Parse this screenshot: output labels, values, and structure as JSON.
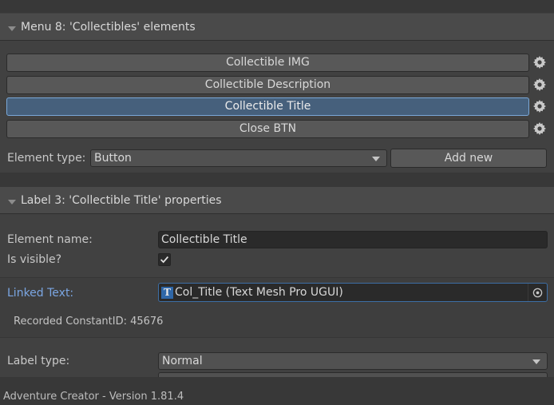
{
  "menu_section": {
    "title": "Menu 8: 'Collectibles' elements",
    "elements": [
      {
        "label": "Collectible IMG",
        "selected": false
      },
      {
        "label": "Collectible Description",
        "selected": false
      },
      {
        "label": "Collectible Title",
        "selected": true
      },
      {
        "label": "Close BTN",
        "selected": false
      }
    ],
    "element_type_label": "Element type:",
    "element_type_value": "Button",
    "add_new_label": "Add new"
  },
  "properties_section": {
    "title": "Label 3: 'Collectible Title' properties",
    "element_name_label": "Element name:",
    "element_name_value": "Collectible Title",
    "is_visible_label": "Is visible?",
    "is_visible_checked": true,
    "linked_text_label": "Linked Text:",
    "linked_text_value": "Col_Title (Text Mesh Pro UGUI)",
    "linked_text_icon": "T",
    "recorded_constant_id": "Recorded ConstantID: 45676",
    "label_type_label": "Label type:",
    "label_type_value": "Normal"
  },
  "footer": {
    "version_text": "Adventure Creator - Version 1.81.4"
  },
  "colors": {
    "background": "#383838",
    "panel": "#414141",
    "selected_button": "#46607c",
    "link_label": "#7ba6e3"
  }
}
